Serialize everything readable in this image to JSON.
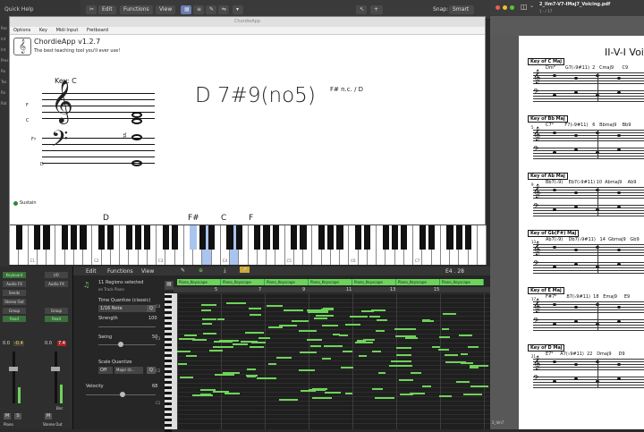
{
  "logic": {
    "quick_help": "Quick Help",
    "menu": [
      "Edit",
      "Functions",
      "View"
    ],
    "snap_label": "Snap:",
    "snap_value": "Smart",
    "side_labels": [
      "Rec",
      "Int",
      "Int",
      "Pres",
      "Ro",
      "Tex",
      "Ro",
      "Rot"
    ]
  },
  "chordie": {
    "window_title": "ChordieApp",
    "menu": [
      "Options",
      "Key",
      "Midi Input",
      "Fretboard"
    ],
    "app_name": "ChordieApp v1.2.7",
    "tagline": "The best teaching tool you'll ever use!",
    "key_label": "Key: C",
    "chord_name": "D 7#9(no5)",
    "alt_name": "F# n.c. / D",
    "note_letters": [
      "F",
      "C",
      "F♯",
      "D"
    ],
    "status": "Sustain",
    "keyboard_labels": [
      "D",
      "F#",
      "C",
      "F"
    ],
    "octave_labels": [
      "C1",
      "C2",
      "C3",
      "C4",
      "C5",
      "C6",
      "C7"
    ]
  },
  "mixer": {
    "keyboard": "Keyboard",
    "io": "I/O",
    "audio_fx": "Audio FX",
    "sends": "Sends",
    "stereo_out": "Stereo Out",
    "group": "Group",
    "read": "Read",
    "val_left": "0.0",
    "val_left2": "-0.4",
    "val_right": "0.0",
    "val_right2": "7.4",
    "bnc": "Bnc",
    "m": "M",
    "s": "S",
    "ch_names": [
      "Piano",
      "Stereo Out"
    ]
  },
  "piano_roll": {
    "menu": [
      "Edit",
      "Functions",
      "View"
    ],
    "regions_selected": "11 Regions selected",
    "on_track": "on Track Piano",
    "time_quantize": "Time Quantize (classic)",
    "quant_value": "1/16 Note",
    "q": "Q",
    "strength": "Strength",
    "strength_val": "100",
    "swing": "Swing",
    "swing_val": "50",
    "scale_quantize": "Scale Quantize",
    "off": "Off",
    "major": "Major (tr...",
    "velocity": "Velocity",
    "velocity_val": "68",
    "ruler_nums": [
      "5",
      "7",
      "9",
      "11",
      "13",
      "15"
    ],
    "region_name": "Piano_Keyscape",
    "c_labels": [
      "C4",
      "C3",
      "C2",
      "C1"
    ],
    "position": "E4 . 28"
  },
  "pdf": {
    "file": "2_IIm7-V7-IMaj7_Voicing.pdf",
    "sub": "1 - / 17",
    "heading": "II-V-I Voi",
    "systems": [
      {
        "key": "Key of C Maj",
        "chords": "Dm⁹       G7(♭9#11)  2   Cmaj9      C9",
        "num": ""
      },
      {
        "key": "Key of Bb Maj",
        "chords": "C7⁹        F7(♭9#11)   6   Bbmaj9    Bb9",
        "num": "5"
      },
      {
        "key": "Key of Ab Maj",
        "chords": "Bb7(♭9)    Eb7(♭9#11) 10  Abmaj9    Ab9",
        "num": "9"
      },
      {
        "key": "Key of Gb(F#) Maj",
        "chords": "Ab7(♭9)    Db7(♭9#11)   14  Gbmaj9   Gb9",
        "num": "13"
      },
      {
        "key": "Key of E Maj",
        "chords": "F#7⁹       B7(♭9#11)  18   Emaj9     E9",
        "num": "17"
      },
      {
        "key": "Key of D Maj",
        "chords": "E7⁹     A7(♭9#11)  22   Dmaj9     D9",
        "num": "21"
      }
    ],
    "footer": "2_IIm7"
  },
  "colors": {
    "accent": "#6ed35a",
    "highlight": "#a9c4ef",
    "region_yellow": "#c9a93a"
  }
}
